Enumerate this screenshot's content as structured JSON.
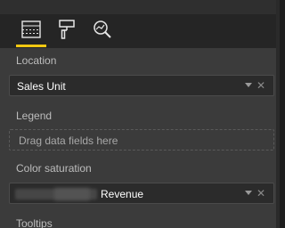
{
  "toolbar": {
    "tabs": [
      {
        "icon": "fields-icon",
        "active": true
      },
      {
        "icon": "format-paint-icon",
        "active": false
      },
      {
        "icon": "analytics-icon",
        "active": false
      }
    ],
    "accent_color": "#f2c811"
  },
  "sections": {
    "location": {
      "label": "Location",
      "value": "Sales Unit"
    },
    "legend": {
      "label": "Legend",
      "placeholder": "Drag data fields here"
    },
    "color_saturation": {
      "label": "Color saturation",
      "value": "Revenue"
    },
    "tooltips": {
      "label": "Tooltips"
    }
  }
}
